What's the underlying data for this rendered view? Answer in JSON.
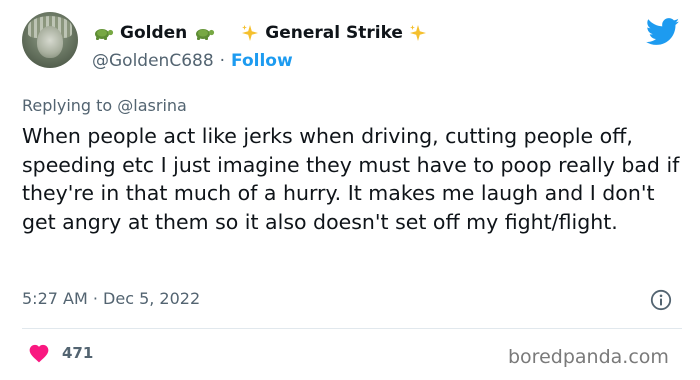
{
  "author": {
    "name_part1": "Golden",
    "name_part2": "General Strike",
    "handle": "@GoldenC688",
    "separator": "·",
    "follow_label": "Follow"
  },
  "reply": {
    "prefix": "Replying to",
    "mention": "@lasrina"
  },
  "tweet": {
    "text": "When people act like jerks when driving, cutting people off, speeding etc I just imagine they must have to poop really bad if they're in that much of a hurry. It makes me laugh and I don't get angry at them so it also doesn't set off my fight/flight.",
    "timestamp": "5:27 AM · Dec 5, 2022"
  },
  "engagement": {
    "likes": "471"
  },
  "watermark": "boredpanda.com",
  "colors": {
    "accent": "#1d9bf0",
    "like": "#f91880",
    "secondary_text": "#536471"
  }
}
